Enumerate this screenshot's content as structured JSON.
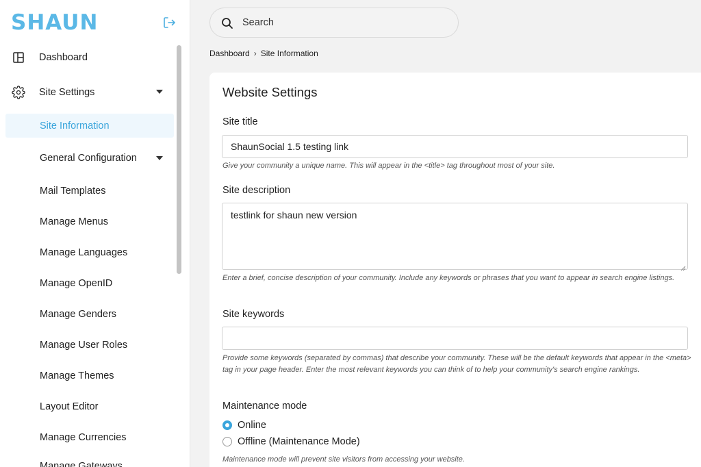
{
  "brand": {
    "logo_text": "SHAUN",
    "accent": "#5bb8e6"
  },
  "sidebar": {
    "items": [
      {
        "label": "Dashboard",
        "icon": "dashboard-icon"
      },
      {
        "label": "Site Settings",
        "icon": "gear-icon"
      }
    ],
    "sub_items": [
      "Site Information",
      "General Configuration",
      "Mail Templates",
      "Manage Menus",
      "Manage Languages",
      "Manage OpenID",
      "Manage Genders",
      "Manage User Roles",
      "Manage Themes",
      "Layout Editor",
      "Manage Currencies",
      "Manage Gateways"
    ]
  },
  "search": {
    "placeholder": "Search"
  },
  "breadcrumb": {
    "home": "Dashboard",
    "current": "Site Information"
  },
  "form": {
    "title": "Website Settings",
    "site_title": {
      "label": "Site title",
      "value": "ShaunSocial 1.5 testing link",
      "help": "Give your community a unique name. This will appear in the <title> tag throughout most of your site."
    },
    "site_description": {
      "label": "Site description",
      "value": "testlink for shaun new version",
      "help": "Enter a brief, concise description of your community. Include any keywords or phrases that you want to appear in search engine listings."
    },
    "site_keywords": {
      "label": "Site keywords",
      "value": "",
      "help": "Provide some keywords (separated by commas) that describe your community. These will be the default keywords that appear in the <meta> tag in your page header. Enter the most relevant keywords you can think of to help your community's search engine rankings."
    },
    "maintenance": {
      "label": "Maintenance mode",
      "options": [
        "Online",
        "Offline (Maintenance Mode)"
      ],
      "selected": "Online",
      "help": "Maintenance mode will prevent site visitors from accessing your website."
    }
  }
}
